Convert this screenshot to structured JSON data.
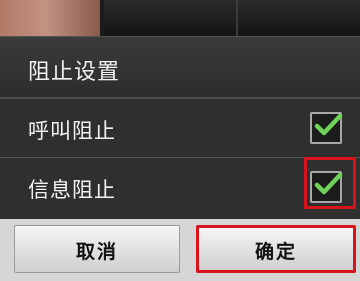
{
  "dialog": {
    "title": "阻止设置",
    "items": [
      {
        "label": "呼叫阻止",
        "checked": true
      },
      {
        "label": "信息阻止",
        "checked": true
      }
    ],
    "cancel_label": "取消",
    "ok_label": "确定"
  },
  "colors": {
    "dialog_bg": "#303030",
    "check_green": "#6fd35a",
    "highlight_red": "#d8131c",
    "button_bg": "#e6e6e6"
  }
}
